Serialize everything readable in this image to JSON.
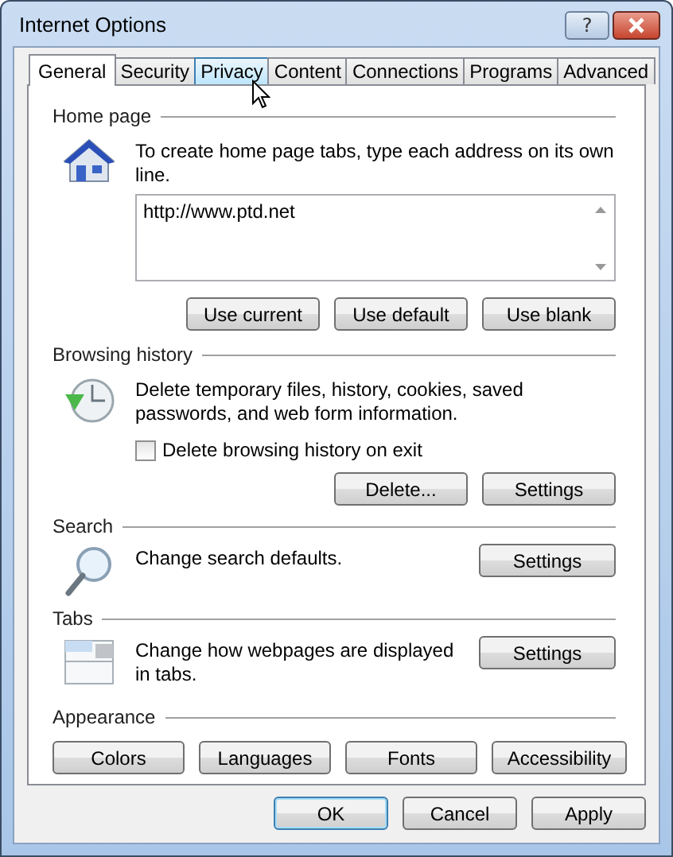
{
  "window": {
    "title": "Internet Options",
    "help_button": "?"
  },
  "tabs": [
    {
      "label": "General",
      "selected": true,
      "hovered": false
    },
    {
      "label": "Security",
      "selected": false,
      "hovered": false
    },
    {
      "label": "Privacy",
      "selected": false,
      "hovered": true
    },
    {
      "label": "Content",
      "selected": false,
      "hovered": false
    },
    {
      "label": "Connections",
      "selected": false,
      "hovered": false
    },
    {
      "label": "Programs",
      "selected": false,
      "hovered": false
    },
    {
      "label": "Advanced",
      "selected": false,
      "hovered": false
    }
  ],
  "sections": [
    {
      "kind": "home",
      "heading": "Home page",
      "description": "To create home page tabs, type each address on its own line.",
      "field_value": "http://www.ptd.net",
      "buttons": [
        "Use current",
        "Use default",
        "Use blank"
      ]
    },
    {
      "kind": "history",
      "heading": "Browsing history",
      "description": "Delete temporary files, history, cookies, saved passwords, and web form information.",
      "checkbox": {
        "label": "Delete browsing history on exit",
        "checked": false
      },
      "buttons": [
        "Delete...",
        "Settings"
      ]
    },
    {
      "kind": "search",
      "heading": "Search",
      "description": "Change search defaults.",
      "buttons": [
        "Settings"
      ]
    },
    {
      "kind": "tabs",
      "heading": "Tabs",
      "description": "Change how webpages are displayed in tabs.",
      "buttons": [
        "Settings"
      ]
    },
    {
      "kind": "appearance",
      "heading": "Appearance",
      "buttons": [
        "Colors",
        "Languages",
        "Fonts",
        "Accessibility"
      ]
    }
  ],
  "footer_buttons": [
    {
      "label": "OK",
      "default": true
    },
    {
      "label": "Cancel",
      "default": false
    },
    {
      "label": "Apply",
      "default": false
    }
  ]
}
